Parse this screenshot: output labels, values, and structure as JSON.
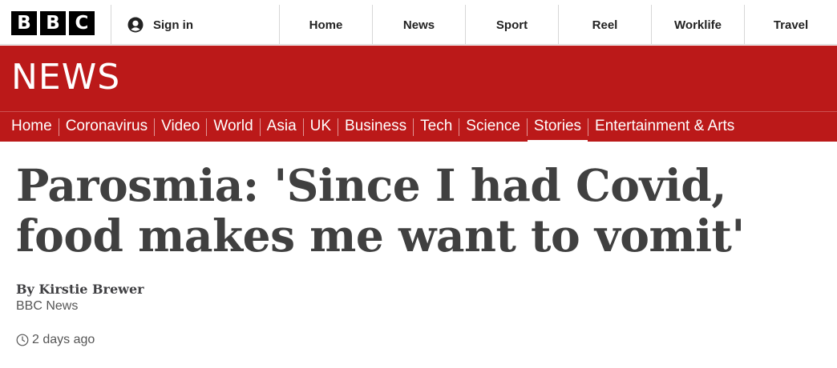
{
  "logo": {
    "letters": [
      "B",
      "B",
      "C"
    ]
  },
  "topnav": {
    "sign_in": "Sign in",
    "items": [
      "Home",
      "News",
      "Sport",
      "Reel",
      "Worklife",
      "Travel"
    ]
  },
  "masthead": {
    "title": "NEWS"
  },
  "subnav": {
    "items": [
      "Home",
      "Coronavirus",
      "Video",
      "World",
      "Asia",
      "UK",
      "Business",
      "Tech",
      "Science",
      "Stories",
      "Entertainment & Arts"
    ],
    "active": "Stories"
  },
  "article": {
    "headline": "Parosmia: 'Since I had Covid, food makes me want to vomit'",
    "byline": "By Kirstie Brewer",
    "source": "BBC News",
    "timestamp": "2 days ago"
  },
  "colors": {
    "brand_red": "#bb1919",
    "logo_black": "#000000",
    "text_dark": "#404040"
  },
  "icons": {
    "sign_in": "user-icon",
    "timestamp": "clock-icon"
  }
}
